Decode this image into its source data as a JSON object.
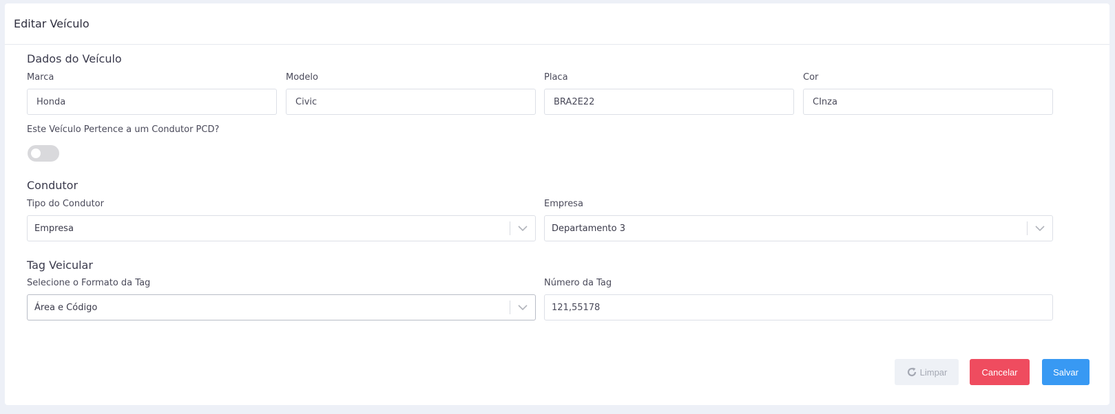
{
  "header": {
    "title": "Editar Veículo"
  },
  "vehicle": {
    "section_title": "Dados do Veículo",
    "brand_label": "Marca",
    "brand_value": "Honda",
    "model_label": "Modelo",
    "model_value": "Civic",
    "plate_label": "Placa",
    "plate_value": "BRA2E22",
    "color_label": "Cor",
    "color_value": "CInza",
    "pcd_label": "Este Veículo Pertence a um Condutor PCD?",
    "pcd_enabled": false
  },
  "driver": {
    "section_title": "Condutor",
    "type_label": "Tipo do Condutor",
    "type_value": "Empresa",
    "company_label": "Empresa",
    "company_value": "Departamento 3"
  },
  "tag": {
    "section_title": "Tag Veicular",
    "format_label": "Selecione o Formato da Tag",
    "format_value": "Área e Código",
    "number_label": "Número da Tag",
    "number_value": "121,55178"
  },
  "actions": {
    "clear_label": "Limpar",
    "cancel_label": "Cancelar",
    "save_label": "Salvar"
  },
  "icons": {
    "clear": "refresh-icon",
    "dropdown": "chevron-down-icon"
  },
  "colors": {
    "cancel": "#ef4c5f",
    "save": "#3899f3",
    "clear_bg": "#eef1f6"
  }
}
